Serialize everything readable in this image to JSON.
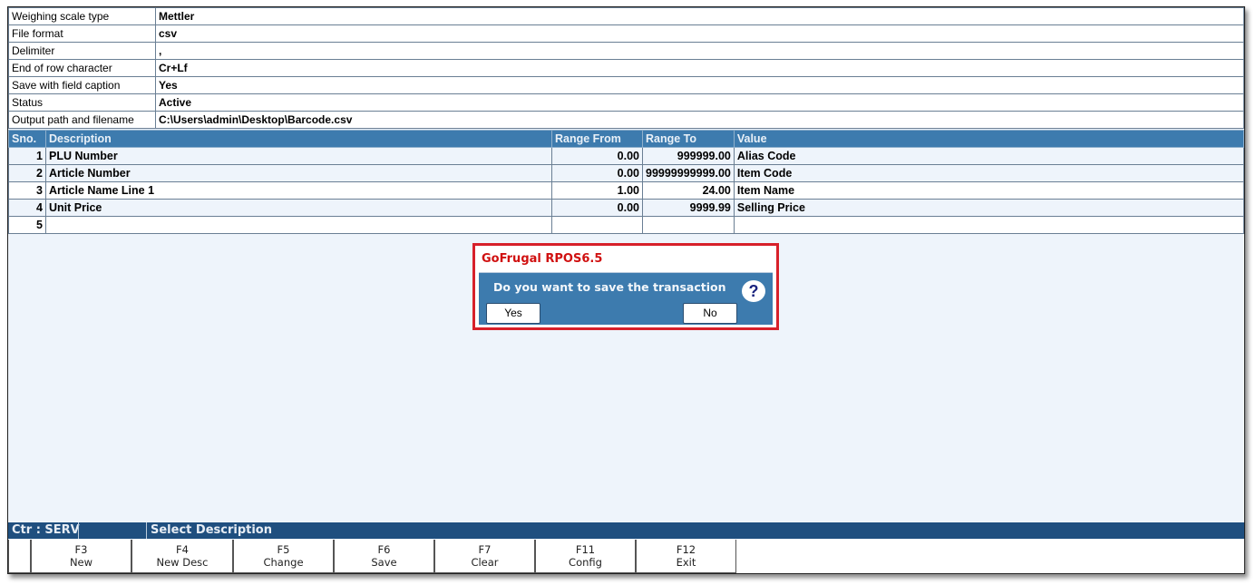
{
  "settings": [
    {
      "label": "Weighing scale type",
      "value": "Mettler"
    },
    {
      "label": "File format",
      "value": "csv"
    },
    {
      "label": "Delimiter",
      "value": ","
    },
    {
      "label": "End of row character",
      "value": "Cr+Lf"
    },
    {
      "label": "Save with field caption",
      "value": "Yes"
    },
    {
      "label": "Status",
      "value": "Active"
    },
    {
      "label": "Output path and filename",
      "value": "C:\\Users\\admin\\Desktop\\Barcode.csv"
    }
  ],
  "grid": {
    "headers": [
      "Sno.",
      "Description",
      "Range From",
      "Range To",
      "Value"
    ],
    "rows": [
      [
        "1",
        "PLU Number",
        "0.00",
        "999999.00",
        "Alias Code"
      ],
      [
        "2",
        "Article Number",
        "0.00",
        "99999999999.00",
        "Item Code"
      ],
      [
        "3",
        "Article Name Line 1",
        "1.00",
        "24.00",
        "Item Name"
      ],
      [
        "4",
        "Unit Price",
        "0.00",
        "9999.99",
        "Selling Price"
      ],
      [
        "5",
        "",
        "",
        "",
        ""
      ]
    ]
  },
  "dialog": {
    "title": "GoFrugal RPOS6.5",
    "message": "Do you want to save the transaction",
    "yes": "Yes",
    "no": "No",
    "icon": "?"
  },
  "status": {
    "counter": "Ctr : SERV",
    "message": "Select Description"
  },
  "fkeys": [
    {
      "key": "F3",
      "label": "New"
    },
    {
      "key": "F4",
      "label": "New Desc"
    },
    {
      "key": "F5",
      "label": "Change"
    },
    {
      "key": "F6",
      "label": "Save"
    },
    {
      "key": "F7",
      "label": "Clear"
    },
    {
      "key": "F11",
      "label": "Config"
    },
    {
      "key": "F12",
      "label": "Exit"
    }
  ]
}
